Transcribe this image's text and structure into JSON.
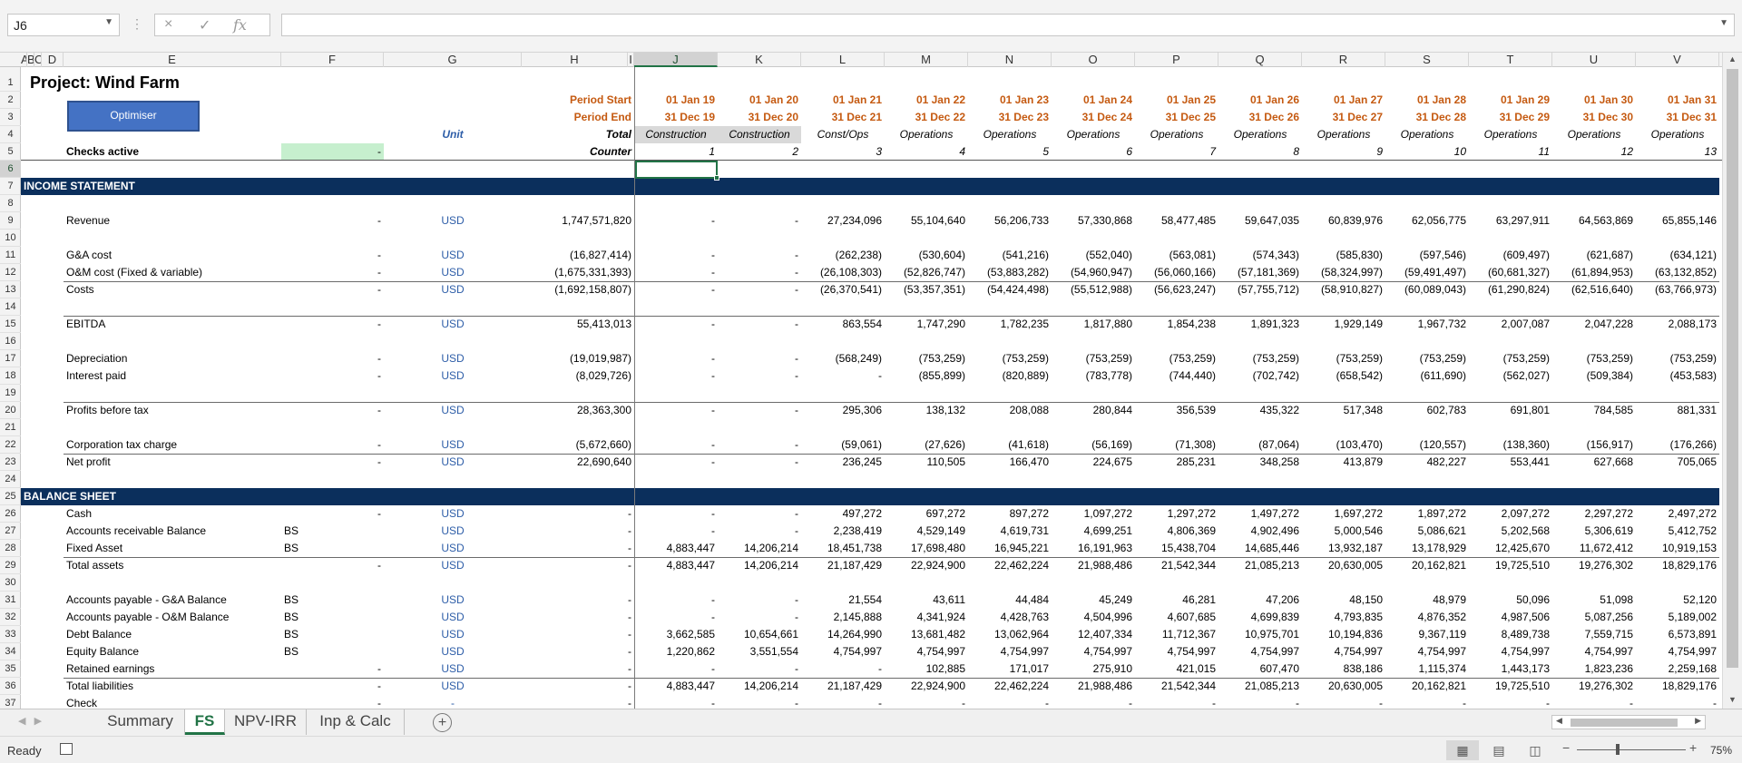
{
  "formula_bar": {
    "name_box": "J6",
    "formula": ""
  },
  "columns": {
    "A": "A",
    "B": "B",
    "C": "C",
    "D": "D",
    "E": "E",
    "F": "F",
    "G": "G",
    "H": "H",
    "I": "I",
    "J": "J",
    "K": "K",
    "L": "L",
    "M": "M",
    "N": "N",
    "O": "O",
    "P": "P",
    "Q": "Q",
    "R": "R",
    "S": "S",
    "T": "T",
    "U": "U",
    "V": "V"
  },
  "title": "Project: Wind Farm",
  "optimiser": "Optimiser",
  "header": {
    "period_start_label": "Period Start",
    "period_end_label": "Period End",
    "unit_label": "Unit",
    "total_label": "Total",
    "checks_label": "Checks active",
    "checks_value": "-",
    "counter_label": "Counter",
    "start": [
      "01 Jan 19",
      "01 Jan 20",
      "01 Jan 21",
      "01 Jan 22",
      "01 Jan 23",
      "01 Jan 24",
      "01 Jan 25",
      "01 Jan 26",
      "01 Jan 27",
      "01 Jan 28",
      "01 Jan 29",
      "01 Jan 30",
      "01 Jan 31"
    ],
    "end": [
      "31 Dec 19",
      "31 Dec 20",
      "31 Dec 21",
      "31 Dec 22",
      "31 Dec 23",
      "31 Dec 24",
      "31 Dec 25",
      "31 Dec 26",
      "31 Dec 27",
      "31 Dec 28",
      "31 Dec 29",
      "31 Dec 30",
      "31 Dec 31"
    ],
    "phase": [
      "Construction",
      "Construction",
      "Const/Ops",
      "Operations",
      "Operations",
      "Operations",
      "Operations",
      "Operations",
      "Operations",
      "Operations",
      "Operations",
      "Operations",
      "Operations"
    ],
    "counter": [
      "1",
      "2",
      "3",
      "4",
      "5",
      "6",
      "7",
      "8",
      "9",
      "10",
      "11",
      "12",
      "13"
    ]
  },
  "sections": {
    "income": "INCOME STATEMENT",
    "balance": "BALANCE SHEET"
  },
  "rows": {
    "r9": {
      "label": "Revenue",
      "f": "-",
      "unit": "USD",
      "total": "1,747,571,820",
      "vals": [
        "-",
        "-",
        "27,234,096",
        "55,104,640",
        "56,206,733",
        "57,330,868",
        "58,477,485",
        "59,647,035",
        "60,839,976",
        "62,056,775",
        "63,297,911",
        "64,563,869",
        "65,855,146"
      ]
    },
    "r11": {
      "label": "G&A cost",
      "f": "-",
      "unit": "USD",
      "total": "(16,827,414)",
      "vals": [
        "-",
        "-",
        "(262,238)",
        "(530,604)",
        "(541,216)",
        "(552,040)",
        "(563,081)",
        "(574,343)",
        "(585,830)",
        "(597,546)",
        "(609,497)",
        "(621,687)",
        "(634,121)"
      ]
    },
    "r12": {
      "label": "O&M cost (Fixed & variable)",
      "f": "-",
      "unit": "USD",
      "total": "(1,675,331,393)",
      "vals": [
        "-",
        "-",
        "(26,108,303)",
        "(52,826,747)",
        "(53,883,282)",
        "(54,960,947)",
        "(56,060,166)",
        "(57,181,369)",
        "(58,324,997)",
        "(59,491,497)",
        "(60,681,327)",
        "(61,894,953)",
        "(63,132,852)"
      ]
    },
    "r13": {
      "label": "Costs",
      "f": "-",
      "unit": "USD",
      "total": "(1,692,158,807)",
      "vals": [
        "-",
        "-",
        "(26,370,541)",
        "(53,357,351)",
        "(54,424,498)",
        "(55,512,988)",
        "(56,623,247)",
        "(57,755,712)",
        "(58,910,827)",
        "(60,089,043)",
        "(61,290,824)",
        "(62,516,640)",
        "(63,766,973)"
      ]
    },
    "r15": {
      "label": "EBITDA",
      "f": "-",
      "unit": "USD",
      "total": "55,413,013",
      "vals": [
        "-",
        "-",
        "863,554",
        "1,747,290",
        "1,782,235",
        "1,817,880",
        "1,854,238",
        "1,891,323",
        "1,929,149",
        "1,967,732",
        "2,007,087",
        "2,047,228",
        "2,088,173"
      ]
    },
    "r17": {
      "label": "Depreciation",
      "f": "-",
      "unit": "USD",
      "total": "(19,019,987)",
      "vals": [
        "-",
        "-",
        "(568,249)",
        "(753,259)",
        "(753,259)",
        "(753,259)",
        "(753,259)",
        "(753,259)",
        "(753,259)",
        "(753,259)",
        "(753,259)",
        "(753,259)",
        "(753,259)"
      ]
    },
    "r18": {
      "label": "Interest paid",
      "f": "-",
      "unit": "USD",
      "total": "(8,029,726)",
      "vals": [
        "-",
        "-",
        "-",
        "(855,899)",
        "(820,889)",
        "(783,778)",
        "(744,440)",
        "(702,742)",
        "(658,542)",
        "(611,690)",
        "(562,027)",
        "(509,384)",
        "(453,583)"
      ]
    },
    "r20": {
      "label": "Profits before tax",
      "f": "-",
      "unit": "USD",
      "total": "28,363,300",
      "vals": [
        "-",
        "-",
        "295,306",
        "138,132",
        "208,088",
        "280,844",
        "356,539",
        "435,322",
        "517,348",
        "602,783",
        "691,801",
        "784,585",
        "881,331"
      ]
    },
    "r22": {
      "label": "Corporation tax charge",
      "f": "-",
      "unit": "USD",
      "total": "(5,672,660)",
      "vals": [
        "-",
        "-",
        "(59,061)",
        "(27,626)",
        "(41,618)",
        "(56,169)",
        "(71,308)",
        "(87,064)",
        "(103,470)",
        "(120,557)",
        "(138,360)",
        "(156,917)",
        "(176,266)"
      ]
    },
    "r23": {
      "label": "Net profit",
      "f": "-",
      "unit": "USD",
      "total": "22,690,640",
      "vals": [
        "-",
        "-",
        "236,245",
        "110,505",
        "166,470",
        "224,675",
        "285,231",
        "348,258",
        "413,879",
        "482,227",
        "553,441",
        "627,668",
        "705,065"
      ]
    },
    "r26": {
      "label": "Cash",
      "f": "-",
      "unit": "USD",
      "total": "-",
      "vals": [
        "-",
        "-",
        "497,272",
        "697,272",
        "897,272",
        "1,097,272",
        "1,297,272",
        "1,497,272",
        "1,697,272",
        "1,897,272",
        "2,097,272",
        "2,297,272",
        "2,497,272"
      ]
    },
    "r27": {
      "label": "Accounts receivable Balance",
      "f": "BS",
      "unit": "USD",
      "total": "-",
      "vals": [
        "-",
        "-",
        "2,238,419",
        "4,529,149",
        "4,619,731",
        "4,699,251",
        "4,806,369",
        "4,902,496",
        "5,000,546",
        "5,086,621",
        "5,202,568",
        "5,306,619",
        "5,412,752"
      ]
    },
    "r28": {
      "label": "Fixed Asset",
      "f": "BS",
      "unit": "USD",
      "total": "-",
      "vals": [
        "4,883,447",
        "14,206,214",
        "18,451,738",
        "17,698,480",
        "16,945,221",
        "16,191,963",
        "15,438,704",
        "14,685,446",
        "13,932,187",
        "13,178,929",
        "12,425,670",
        "11,672,412",
        "10,919,153"
      ]
    },
    "r29": {
      "label": "Total assets",
      "f": "-",
      "unit": "USD",
      "total": "-",
      "vals": [
        "4,883,447",
        "14,206,214",
        "21,187,429",
        "22,924,900",
        "22,462,224",
        "21,988,486",
        "21,542,344",
        "21,085,213",
        "20,630,005",
        "20,162,821",
        "19,725,510",
        "19,276,302",
        "18,829,176"
      ]
    },
    "r31": {
      "label": "Accounts payable - G&A Balance",
      "f": "BS",
      "unit": "USD",
      "total": "-",
      "vals": [
        "-",
        "-",
        "21,554",
        "43,611",
        "44,484",
        "45,249",
        "46,281",
        "47,206",
        "48,150",
        "48,979",
        "50,096",
        "51,098",
        "52,120"
      ]
    },
    "r32": {
      "label": "Accounts payable - O&M Balance",
      "f": "BS",
      "unit": "USD",
      "total": "-",
      "vals": [
        "-",
        "-",
        "2,145,888",
        "4,341,924",
        "4,428,763",
        "4,504,996",
        "4,607,685",
        "4,699,839",
        "4,793,835",
        "4,876,352",
        "4,987,506",
        "5,087,256",
        "5,189,002"
      ]
    },
    "r33": {
      "label": "Debt Balance",
      "f": "BS",
      "unit": "USD",
      "total": "-",
      "vals": [
        "3,662,585",
        "10,654,661",
        "14,264,990",
        "13,681,482",
        "13,062,964",
        "12,407,334",
        "11,712,367",
        "10,975,701",
        "10,194,836",
        "9,367,119",
        "8,489,738",
        "7,559,715",
        "6,573,891"
      ]
    },
    "r34": {
      "label": "Equity Balance",
      "f": "BS",
      "unit": "USD",
      "total": "-",
      "vals": [
        "1,220,862",
        "3,551,554",
        "4,754,997",
        "4,754,997",
        "4,754,997",
        "4,754,997",
        "4,754,997",
        "4,754,997",
        "4,754,997",
        "4,754,997",
        "4,754,997",
        "4,754,997",
        "4,754,997"
      ]
    },
    "r35": {
      "label": "Retained earnings",
      "f": "-",
      "unit": "USD",
      "total": "-",
      "vals": [
        "-",
        "-",
        "-",
        "102,885",
        "171,017",
        "275,910",
        "421,015",
        "607,470",
        "838,186",
        "1,115,374",
        "1,443,173",
        "1,823,236",
        "2,259,168"
      ]
    },
    "r36": {
      "label": "Total liabilities",
      "f": "-",
      "unit": "USD",
      "total": "-",
      "vals": [
        "4,883,447",
        "14,206,214",
        "21,187,429",
        "22,924,900",
        "22,462,224",
        "21,988,486",
        "21,542,344",
        "21,085,213",
        "20,630,005",
        "20,162,821",
        "19,725,510",
        "19,276,302",
        "18,829,176"
      ]
    },
    "r37": {
      "label": "Check",
      "f": "-",
      "unit": "-",
      "total": "-",
      "vals": [
        "-",
        "-",
        "-",
        "-",
        "-",
        "-",
        "-",
        "-",
        "-",
        "-",
        "-",
        "-",
        "-"
      ]
    }
  },
  "tabs": [
    "Summary",
    "FS",
    "NPV-IRR",
    "Inp & Calc"
  ],
  "active_tab": "FS",
  "status": {
    "ready": "Ready",
    "zoom": "75%"
  },
  "icons": {
    "cancel": "×",
    "enter": "✓",
    "fx": "fx",
    "add": "+"
  }
}
